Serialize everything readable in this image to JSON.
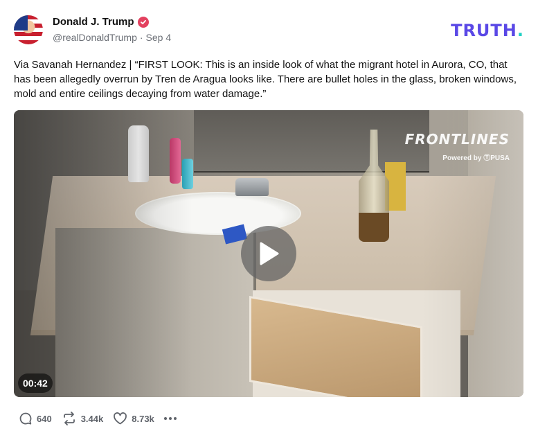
{
  "author": {
    "display_name": "Donald J. Trump",
    "handle": "@realDonaldTrump",
    "separator": "·",
    "date": "Sep 4",
    "verified_icon": "verified-badge-icon",
    "verified_color": "#e3415f"
  },
  "brand": {
    "logo_text": "TRUTH",
    "logo_dot": ".",
    "logo_color": "#5a48e6",
    "dot_color": "#1fd0c4"
  },
  "post": {
    "text": "Via Savanah Hernandez | “FIRST LOOK: This is an inside look of what the migrant hotel in Aurora, CO, that has been allegedly overrun by Tren de Aragua looks like. There are bullet holes in the glass, broken windows, mold and entire ceilings decaying from water damage.”"
  },
  "media": {
    "watermark_title": "FRONTLINES",
    "watermark_sub": "Powered by ⓉPUSA",
    "duration": "00:42",
    "play_icon": "play-icon"
  },
  "actions": {
    "replies": "640",
    "retruths": "3.44k",
    "likes": "8.73k",
    "reply_icon": "comment-icon",
    "retruth_icon": "retruth-icon",
    "like_icon": "heart-icon",
    "more_icon": "more-dots-icon"
  }
}
